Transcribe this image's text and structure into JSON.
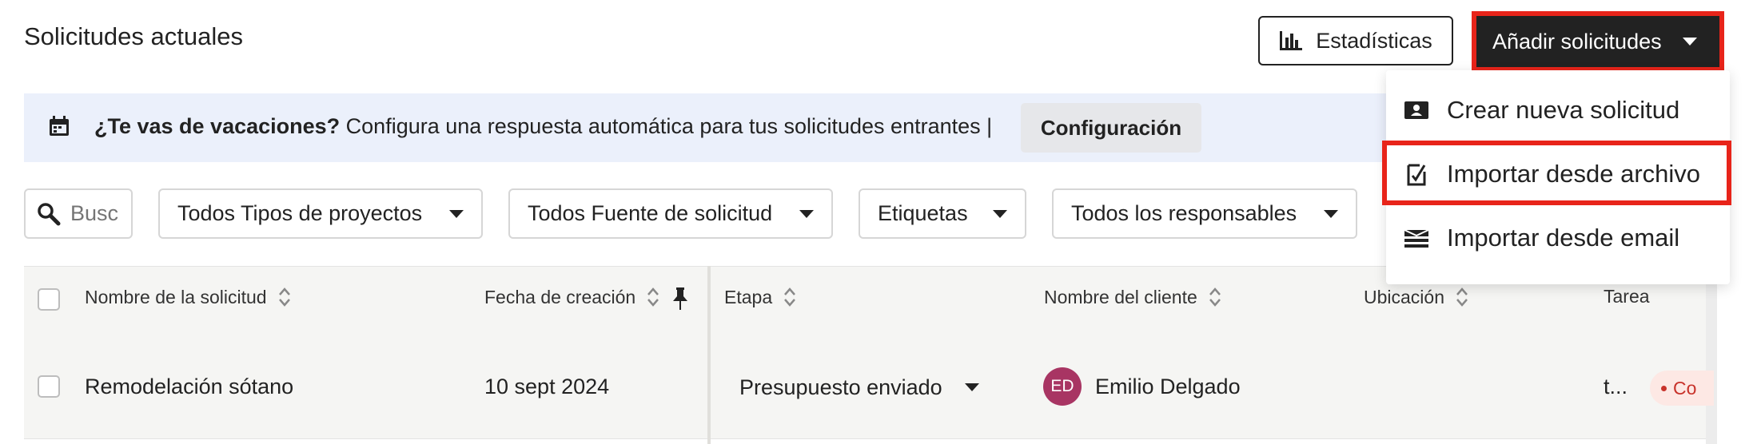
{
  "header": {
    "title": "Solicitudes actuales",
    "stats_label": "Estadísticas",
    "add_label": "Añadir solicitudes"
  },
  "banner": {
    "question": "¿Te vas de vacaciones?",
    "message": " Configura una respuesta automática para tus solicitudes entrantes |",
    "config_label": "Configuración"
  },
  "filters": {
    "search_placeholder": "Busc",
    "project_types": "Todos Tipos de proyectos",
    "sources": "Todos Fuente de solicitud",
    "tags": "Etiquetas",
    "owners": "Todos los responsables"
  },
  "table": {
    "columns": [
      "Nombre de la solicitud",
      "Fecha de creación",
      "Etapa",
      "Nombre del cliente",
      "Ubicación",
      "Tarea"
    ],
    "rows": [
      {
        "name": "Remodelación sótano",
        "created": "10 sept 2024",
        "stage": "Presupuesto enviado",
        "client_initials": "ED",
        "client": "Emilio Delgado",
        "location": "",
        "task": "t...",
        "badge": "Co"
      }
    ]
  },
  "menu": {
    "items": [
      "Crear nueva solicitud",
      "Importar desde archivo",
      "Importar desde email"
    ],
    "highlighted_index": 1
  },
  "colors": {
    "highlight": "#e8241a",
    "primary_button": "#222222",
    "banner_bg": "#ebf0fb",
    "avatar": "#a83563"
  }
}
